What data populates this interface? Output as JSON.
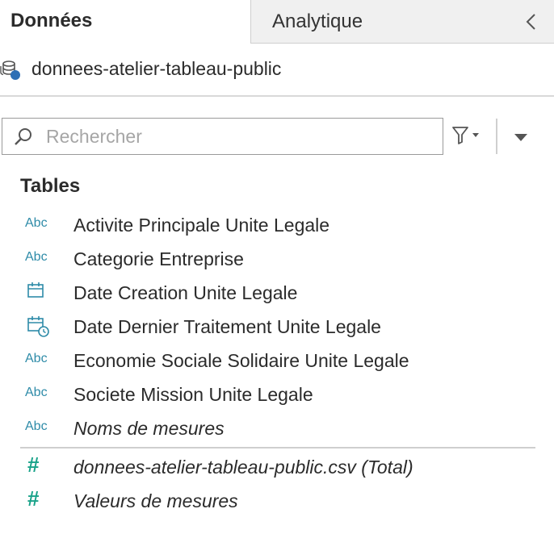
{
  "tabs": {
    "data_label": "Données",
    "analytics_label": "Analytique"
  },
  "datasource": {
    "name": "donnees-atelier-tableau-public",
    "icon": "datasource-icon",
    "status_color": "#2e6fb5"
  },
  "search": {
    "placeholder": "Rechercher",
    "value": ""
  },
  "section": {
    "title": "Tables"
  },
  "dimensions": [
    {
      "type": "Abc",
      "label": "Activite Principale Unite Legale"
    },
    {
      "type": "Abc",
      "label": "Categorie Entreprise"
    },
    {
      "type": "date-icon",
      "label": "Date Creation Unite Legale"
    },
    {
      "type": "datetime-icon",
      "label": "Date Dernier Traitement Unite Legale"
    },
    {
      "type": "Abc",
      "label": "Economie Sociale Solidaire Unite Legale"
    },
    {
      "type": "Abc",
      "label": "Societe Mission Unite Legale"
    },
    {
      "type": "Abc",
      "label": "Noms de mesures"
    }
  ],
  "measures": [
    {
      "type": "#",
      "label": "donnees-atelier-tableau-public.csv (Total)"
    },
    {
      "type": "#",
      "label": "Valeurs de mesures"
    }
  ],
  "colors": {
    "dimension_accent": "#2e8ba8",
    "measure_accent": "#1aa38a"
  }
}
